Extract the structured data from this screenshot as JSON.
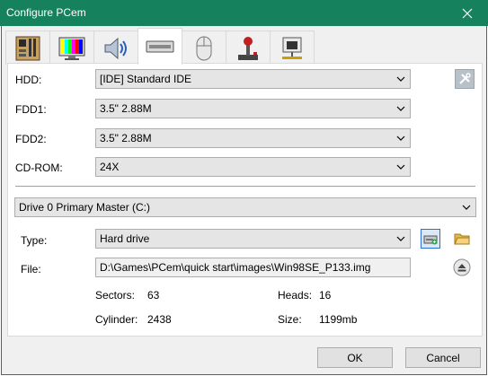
{
  "window": {
    "title": "Configure PCem"
  },
  "tabs": [
    {
      "icon": "motherboard-icon"
    },
    {
      "icon": "monitor-icon"
    },
    {
      "icon": "speaker-icon"
    },
    {
      "icon": "drive-icon",
      "active": true
    },
    {
      "icon": "mouse-icon"
    },
    {
      "icon": "joystick-icon"
    },
    {
      "icon": "network-icon"
    }
  ],
  "drives": {
    "hdd_label": "HDD:",
    "hdd_value": "[IDE] Standard IDE",
    "fdd1_label": "FDD1:",
    "fdd1_value": "3.5\" 2.88M",
    "fdd2_label": "FDD2:",
    "fdd2_value": "3.5\" 2.88M",
    "cdrom_label": "CD-ROM:",
    "cdrom_value": "24X"
  },
  "disk": {
    "drive_select": "Drive 0 Primary Master (C:)",
    "type_label": "Type:",
    "type_value": "Hard drive",
    "file_label": "File:",
    "file_value": "D:\\Games\\PCem\\quick start\\images\\Win98SE_P133.img",
    "sectors_label": "Sectors:",
    "sectors_value": "63",
    "heads_label": "Heads:",
    "heads_value": "16",
    "cylinder_label": "Cylinder:",
    "cylinder_value": "2438",
    "size_label": "Size:",
    "size_value": "1199mb"
  },
  "buttons": {
    "ok": "OK",
    "cancel": "Cancel"
  },
  "colors": {
    "titlebar": "#16825d",
    "dialog": "#f0f0f0",
    "panel": "#ffffff"
  }
}
